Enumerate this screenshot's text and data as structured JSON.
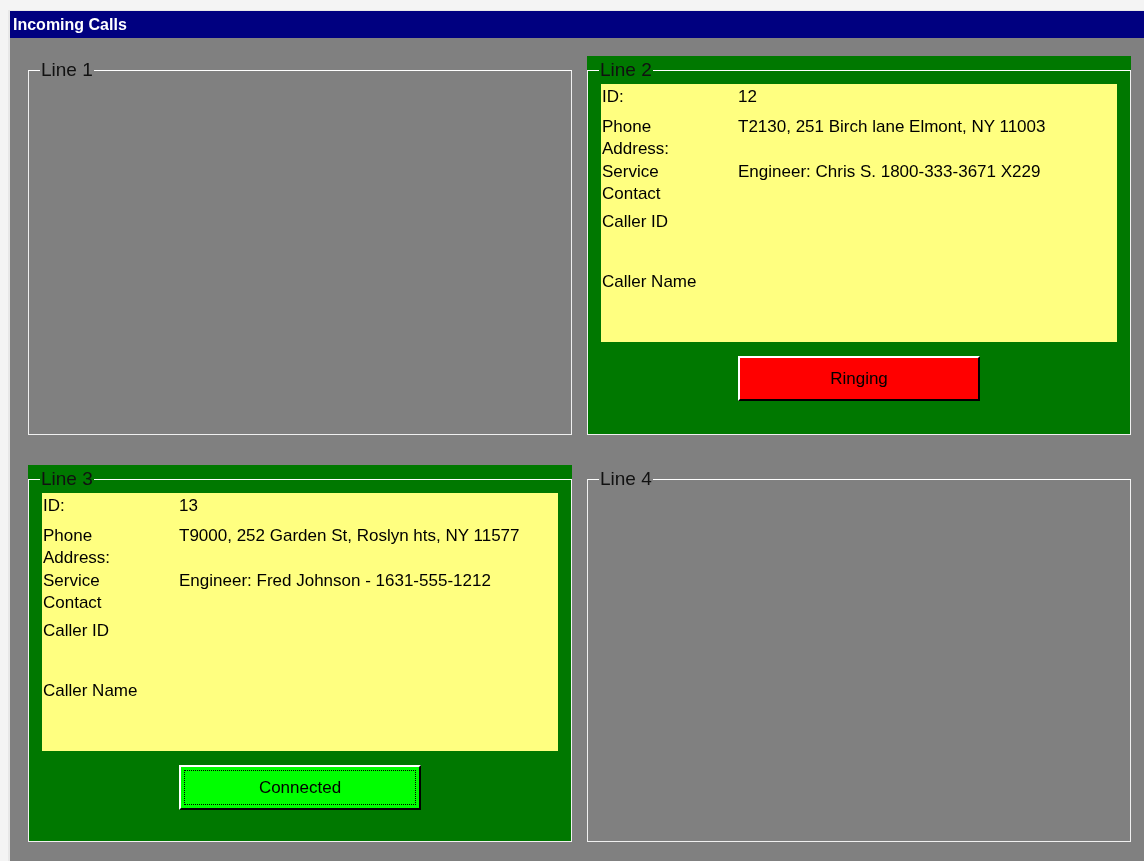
{
  "window": {
    "title": "Incoming Calls"
  },
  "lines": [
    {
      "title": "Line 1",
      "active": false
    },
    {
      "title": "Line 2",
      "active": true,
      "fields": [
        {
          "label": "ID:",
          "value": "12"
        },
        {
          "label": "Phone Address:",
          "value": "T2130, 251 Birch lane Elmont,  NY 11003"
        },
        {
          "label": "Service Contact",
          "value": "Engineer: Chris S. 1800-333-3671 X229"
        },
        {
          "label": "Caller ID"
        },
        {
          "label": "Caller Name"
        }
      ],
      "status": {
        "label": "Ringing",
        "color": "#ff0000",
        "focused": false
      }
    },
    {
      "title": "Line 3",
      "active": true,
      "fields": [
        {
          "label": "ID:",
          "value": "13"
        },
        {
          "label": "Phone Address:",
          "value": "T9000, 252 Garden St, Roslyn hts, NY 11577"
        },
        {
          "label": "Service Contact",
          "value": "Engineer: Fred Johnson - 1631-555-1212"
        },
        {
          "label": "Caller ID"
        },
        {
          "label": "Caller Name"
        }
      ],
      "status": {
        "label": "Connected",
        "color": "#00ff00",
        "focused": true
      }
    },
    {
      "title": "Line 4",
      "active": false
    }
  ]
}
